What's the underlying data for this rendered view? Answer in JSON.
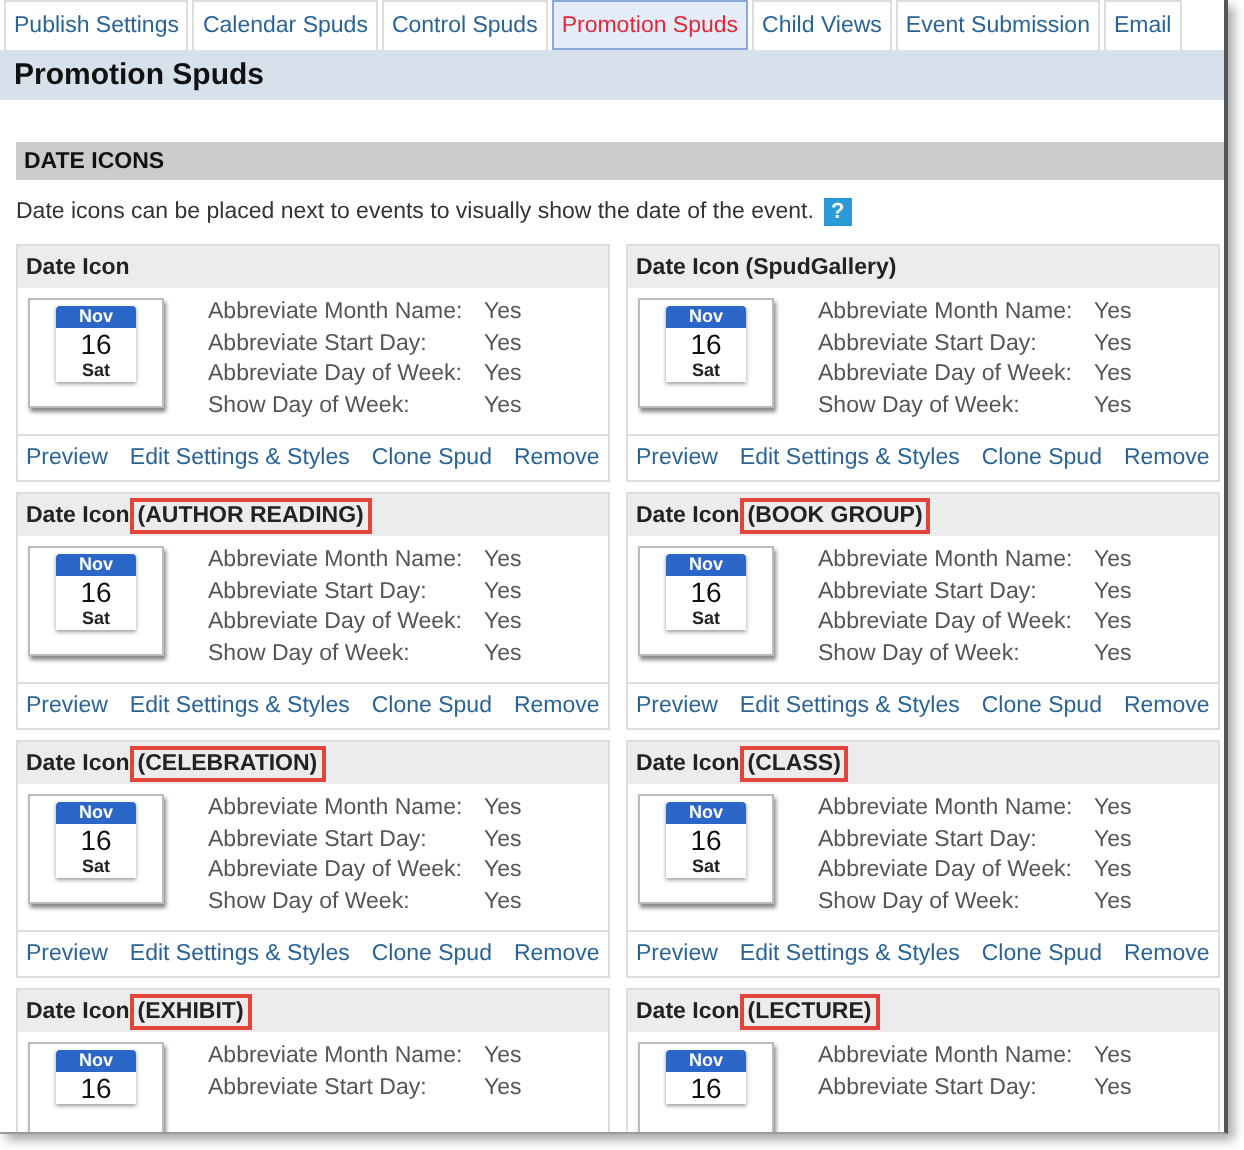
{
  "tabs": [
    {
      "label": "Publish Settings",
      "selected": false
    },
    {
      "label": "Calendar Spuds",
      "selected": false
    },
    {
      "label": "Control Spuds",
      "selected": false
    },
    {
      "label": "Promotion Spuds",
      "selected": true
    },
    {
      "label": "Child Views",
      "selected": false
    },
    {
      "label": "Event Submission",
      "selected": false
    },
    {
      "label": "Email",
      "selected": false
    }
  ],
  "page_title": "Promotion Spuds",
  "section": {
    "title": "DATE ICONS",
    "description": "Date icons can be placed next to events to visually show the date of the event.",
    "help": "?"
  },
  "cards": [
    {
      "title": "Date Icon",
      "icon": {
        "month": "Nov",
        "day": "16",
        "weekday": "Sat"
      },
      "settings": [
        {
          "label": "Abbreviate Month Name:",
          "value": "Yes"
        },
        {
          "label": "Abbreviate Start Day:",
          "value": "Yes"
        },
        {
          "label": "Abbreviate Day of Week:",
          "value": "Yes"
        },
        {
          "label": "Show Day of Week:",
          "value": "Yes"
        }
      ],
      "links": [
        "Preview",
        "Edit Settings & Styles",
        "Clone Spud",
        "Remove"
      ]
    },
    {
      "title": "Date Icon",
      "tag": "(SpudGallery)",
      "highlighted": false,
      "icon": {
        "month": "Nov",
        "day": "16",
        "weekday": "Sat"
      },
      "settings": [
        {
          "label": "Abbreviate Month Name:",
          "value": "Yes"
        },
        {
          "label": "Abbreviate Start Day:",
          "value": "Yes"
        },
        {
          "label": "Abbreviate Day of Week:",
          "value": "Yes"
        },
        {
          "label": "Show Day of Week:",
          "value": "Yes"
        }
      ],
      "links": [
        "Preview",
        "Edit Settings & Styles",
        "Clone Spud",
        "Remove"
      ]
    },
    {
      "title": "Date Icon",
      "tag": "(AUTHOR READING)",
      "highlighted": true,
      "icon": {
        "month": "Nov",
        "day": "16",
        "weekday": "Sat"
      },
      "settings": [
        {
          "label": "Abbreviate Month Name:",
          "value": "Yes"
        },
        {
          "label": "Abbreviate Start Day:",
          "value": "Yes"
        },
        {
          "label": "Abbreviate Day of Week:",
          "value": "Yes"
        },
        {
          "label": "Show Day of Week:",
          "value": "Yes"
        }
      ],
      "links": [
        "Preview",
        "Edit Settings & Styles",
        "Clone Spud",
        "Remove"
      ]
    },
    {
      "title": "Date Icon",
      "tag": "(BOOK GROUP)",
      "highlighted": true,
      "icon": {
        "month": "Nov",
        "day": "16",
        "weekday": "Sat"
      },
      "settings": [
        {
          "label": "Abbreviate Month Name:",
          "value": "Yes"
        },
        {
          "label": "Abbreviate Start Day:",
          "value": "Yes"
        },
        {
          "label": "Abbreviate Day of Week:",
          "value": "Yes"
        },
        {
          "label": "Show Day of Week:",
          "value": "Yes"
        }
      ],
      "links": [
        "Preview",
        "Edit Settings & Styles",
        "Clone Spud",
        "Remove"
      ]
    },
    {
      "title": "Date Icon",
      "tag": "(CELEBRATION)",
      "highlighted": true,
      "icon": {
        "month": "Nov",
        "day": "16",
        "weekday": "Sat"
      },
      "settings": [
        {
          "label": "Abbreviate Month Name:",
          "value": "Yes"
        },
        {
          "label": "Abbreviate Start Day:",
          "value": "Yes"
        },
        {
          "label": "Abbreviate Day of Week:",
          "value": "Yes"
        },
        {
          "label": "Show Day of Week:",
          "value": "Yes"
        }
      ],
      "links": [
        "Preview",
        "Edit Settings & Styles",
        "Clone Spud",
        "Remove"
      ]
    },
    {
      "title": "Date Icon",
      "tag": "(CLASS)",
      "highlighted": true,
      "icon": {
        "month": "Nov",
        "day": "16",
        "weekday": "Sat"
      },
      "settings": [
        {
          "label": "Abbreviate Month Name:",
          "value": "Yes"
        },
        {
          "label": "Abbreviate Start Day:",
          "value": "Yes"
        },
        {
          "label": "Abbreviate Day of Week:",
          "value": "Yes"
        },
        {
          "label": "Show Day of Week:",
          "value": "Yes"
        }
      ],
      "links": [
        "Preview",
        "Edit Settings & Styles",
        "Clone Spud",
        "Remove"
      ]
    },
    {
      "title": "Date Icon",
      "tag": "(EXHIBIT)",
      "highlighted": true,
      "icon": {
        "month": "Nov",
        "day": "16"
      },
      "settings": [
        {
          "label": "Abbreviate Month Name:",
          "value": "Yes"
        },
        {
          "label": "Abbreviate Start Day:",
          "value": "Yes"
        }
      ]
    },
    {
      "title": "Date Icon",
      "tag": "(LECTURE)",
      "highlighted": true,
      "icon": {
        "month": "Nov",
        "day": "16"
      },
      "settings": [
        {
          "label": "Abbreviate Month Name:",
          "value": "Yes"
        },
        {
          "label": "Abbreviate Start Day:",
          "value": "Yes"
        }
      ]
    }
  ]
}
